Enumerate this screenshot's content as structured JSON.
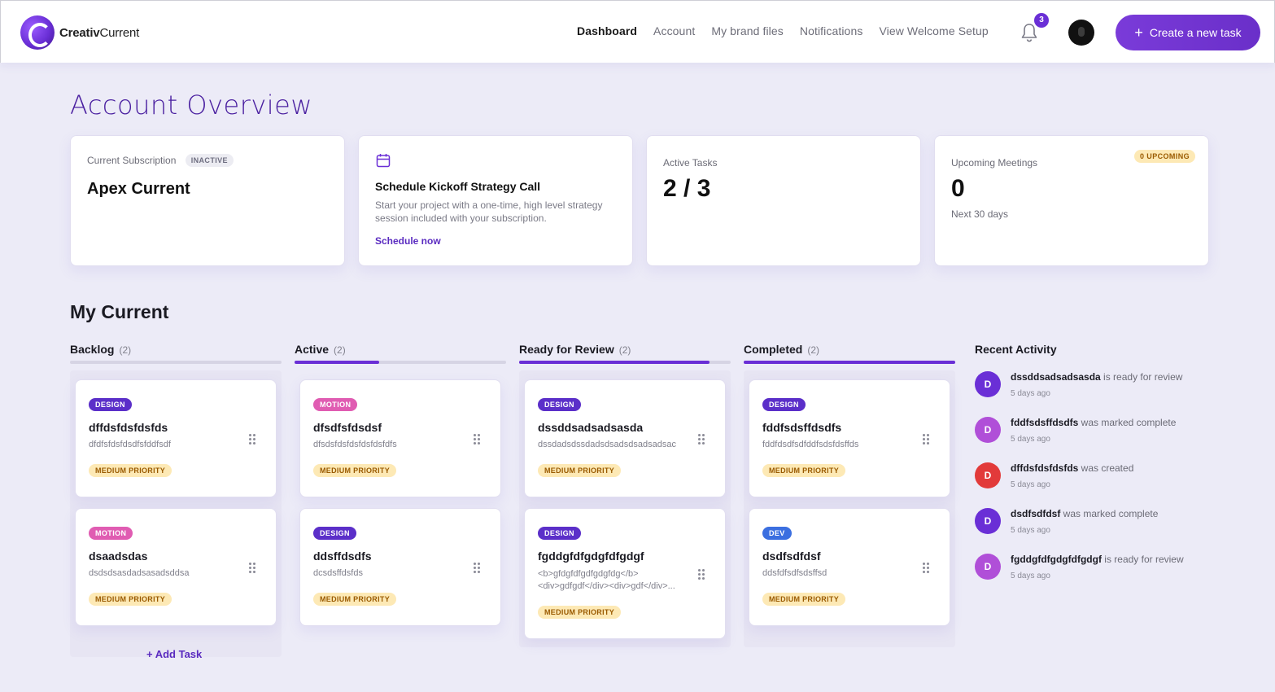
{
  "brand": {
    "name_bold": "Creativ",
    "name_regular": "Current"
  },
  "nav": {
    "items": [
      "Dashboard",
      "Account",
      "My brand files",
      "Notifications",
      "View Welcome Setup"
    ],
    "active": "Dashboard"
  },
  "notifications": {
    "count": "3"
  },
  "header": {
    "create_label": "Create a new task",
    "create_icon": "plus-icon"
  },
  "page_title": "Account Overview",
  "stats": {
    "subscription": {
      "label": "Current Subscription",
      "status": "INACTIVE",
      "value": "Apex Current"
    },
    "kickoff": {
      "icon": "calendar-icon",
      "title": "Schedule Kickoff Strategy Call",
      "desc": "Start your project with a one-time, high level strategy session included with your subscription.",
      "link": "Schedule now"
    },
    "active_tasks": {
      "label": "Active Tasks",
      "value": "2 / 3"
    },
    "meetings": {
      "label": "Upcoming Meetings",
      "badge": "0 UPCOMING",
      "value": "0",
      "sub": "Next 30 days"
    }
  },
  "section_title": "My Current",
  "columns": [
    {
      "title": "Backlog",
      "count": "(2)",
      "progress": 0.0,
      "tasks": [
        {
          "cat": "DESIGN",
          "name": "dffdsfdsfdsfds",
          "desc": "dfdfsfdsfdsdfsfddfsdf",
          "prio": "MEDIUM PRIORITY"
        },
        {
          "cat": "MOTION",
          "name": "dsaadsdas",
          "desc": "dsdsdsasdadsasadsddsa",
          "prio": "MEDIUM PRIORITY"
        }
      ],
      "add_task": "+ Add Task"
    },
    {
      "title": "Active",
      "count": "(2)",
      "progress": 0.4,
      "tasks": [
        {
          "cat": "MOTION",
          "name": "dfsdfsfdsdsf",
          "desc": "dfsdsfdsfdsfdsfdsfdfs",
          "prio": "MEDIUM PRIORITY"
        },
        {
          "cat": "DESIGN",
          "name": "ddsffdsdfs",
          "desc": "dcsdsffdsfds",
          "prio": "MEDIUM PRIORITY"
        }
      ]
    },
    {
      "title": "Ready for Review",
      "count": "(2)",
      "progress": 0.9,
      "tasks": [
        {
          "cat": "DESIGN",
          "name": "dssddsadsadsasda",
          "desc": "dssdadsdssdadsdsadsdsadsadsac",
          "prio": "MEDIUM PRIORITY"
        },
        {
          "cat": "DESIGN",
          "name": "fgddgfdfgdgfdfgdgf",
          "desc": "<b>gfdgfdfgdfgdgfdg</b><div>gdfgdf</div><div>gdf</div>...",
          "prio": "MEDIUM PRIORITY"
        }
      ]
    },
    {
      "title": "Completed",
      "count": "(2)",
      "progress": 1.0,
      "tasks": [
        {
          "cat": "DESIGN",
          "name": "fddfsdsffdsdfs",
          "desc": "fddfdsdfsdfddfsdsfdsffds",
          "prio": "MEDIUM PRIORITY"
        },
        {
          "cat": "DEV",
          "name": "dsdfsdfdsf",
          "desc": "ddsfdfsdfsdsffsd",
          "prio": "MEDIUM PRIORITY"
        }
      ]
    }
  ],
  "category_colors": {
    "DESIGN": "#5b2fc9",
    "MOTION": "#e05cb2",
    "DEV": "#3b6fe0"
  },
  "recent_activity": {
    "title": "Recent Activity",
    "items": [
      {
        "initial": "D",
        "color": "#6a2fd6",
        "name": "dssddsadsadsasda",
        "action": "is ready for review",
        "time": "5 days ago"
      },
      {
        "initial": "D",
        "color": "#b04fd8",
        "name": "fddfsdsffdsdfs",
        "action": "was marked complete",
        "time": "5 days ago"
      },
      {
        "initial": "D",
        "color": "#e23a3a",
        "name": "dffdsfdsfdsfds",
        "action": "was created",
        "time": "5 days ago"
      },
      {
        "initial": "D",
        "color": "#6a2fd6",
        "name": "dsdfsdfdsf",
        "action": "was marked complete",
        "time": "5 days ago"
      },
      {
        "initial": "D",
        "color": "#b04fd8",
        "name": "fgddgfdfgdgfdfgdgf",
        "action": "is ready for review",
        "time": "5 days ago"
      }
    ]
  }
}
